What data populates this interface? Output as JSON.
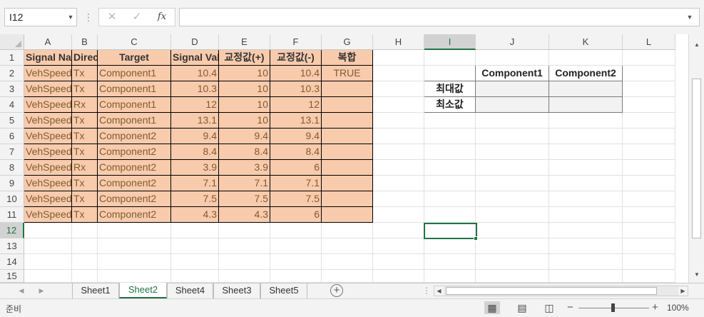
{
  "formula_bar": {
    "name_box": "I12",
    "cancel_icon": "✕",
    "enter_icon": "✓",
    "fx_label": "fx",
    "formula": ""
  },
  "columns": [
    "A",
    "B",
    "C",
    "D",
    "E",
    "F",
    "G",
    "H",
    "I",
    "J",
    "K",
    "L"
  ],
  "selected_column": "I",
  "rows": [
    "1",
    "2",
    "3",
    "4",
    "5",
    "6",
    "7",
    "8",
    "9",
    "10",
    "11",
    "12",
    "13",
    "14",
    "15"
  ],
  "selected_row": "12",
  "table": {
    "headers": [
      "Signal Name",
      "Direction",
      "Target",
      "Signal Value",
      "교정값(+)",
      "교정값(-)",
      "복합"
    ],
    "rows": [
      [
        "VehSpeed",
        "Tx",
        "Component1",
        "10.4",
        "10",
        "10.4",
        "TRUE"
      ],
      [
        "VehSpeed",
        "Tx",
        "Component1",
        "10.3",
        "10",
        "10.3",
        ""
      ],
      [
        "VehSpeed",
        "Rx",
        "Component1",
        "12",
        "10",
        "12",
        ""
      ],
      [
        "VehSpeed",
        "Tx",
        "Component1",
        "13.1",
        "10",
        "13.1",
        ""
      ],
      [
        "VehSpeed",
        "Tx",
        "Component2",
        "9.4",
        "9.4",
        "9.4",
        ""
      ],
      [
        "VehSpeed",
        "Tx",
        "Component2",
        "8.4",
        "8.4",
        "8.4",
        ""
      ],
      [
        "VehSpeed",
        "Rx",
        "Component2",
        "3.9",
        "3.9",
        "6",
        ""
      ],
      [
        "VehSpeed",
        "Tx",
        "Component2",
        "7.1",
        "7.1",
        "7.1",
        ""
      ],
      [
        "VehSpeed",
        "Tx",
        "Component2",
        "7.5",
        "7.5",
        "7.5",
        ""
      ],
      [
        "VehSpeed",
        "Tx",
        "Component2",
        "4.3",
        "4.3",
        "6",
        ""
      ]
    ]
  },
  "summary": {
    "col_headers": [
      "Component1",
      "Component2"
    ],
    "row_labels": [
      "최대값",
      "최소값"
    ]
  },
  "sheets": [
    "Sheet1",
    "Sheet2",
    "Sheet4",
    "Sheet3",
    "Sheet5"
  ],
  "active_sheet": "Sheet2",
  "status": {
    "text": "준비",
    "zoom": "100%"
  },
  "colors": {
    "accent": "#217346",
    "data_fill": "#f8cbad",
    "data_text": "#7f5c2e"
  }
}
